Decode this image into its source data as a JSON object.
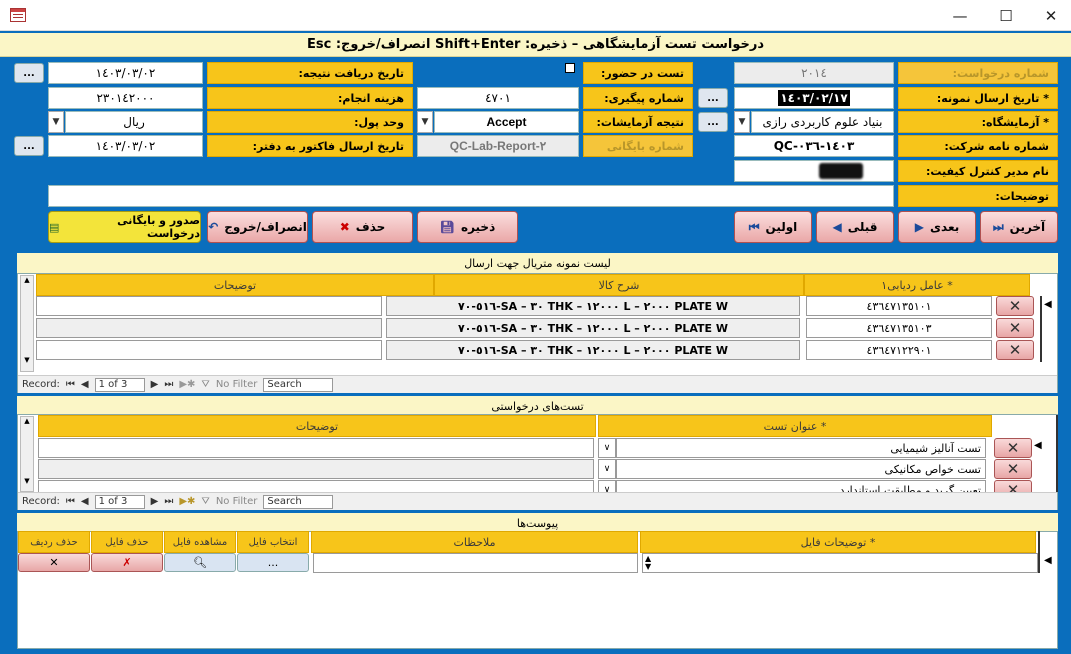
{
  "window": {
    "minimize": "—",
    "maximize": "☐",
    "close": "✕"
  },
  "form_title": "درخواست تست آزمایشگاهی  –  ذخیره: Shift+Enter     انصراف/خروج: Esc",
  "fields": {
    "request_no_label": "شماره درخواست:",
    "request_no": "٢٠١٤",
    "send_date_label": "* تاریخ ارسال نمونه:",
    "send_date": "١٤٠٣/٠٢/١٧",
    "lab_label": "* آزمایشگاه:",
    "lab": "بنیاد علوم کاربردی رازی",
    "letter_no_label": "شماره نامه شرکت:",
    "letter_no": "QC-١٤٠٣-٠٣٦",
    "qc_manager_label": "نام مدیر کنترل کیفیت:",
    "qc_manager": "",
    "notes_label": "توضیحات:",
    "notes": "",
    "attend_label": "تست در حضور:",
    "tracking_label": "شماره پیگیری:",
    "tracking": "٤٧٠١",
    "result_label": "نتیجه آزمایشات:",
    "result": "Accept",
    "archive_label": "شماره بایگانی",
    "archive": "QC-Lab-Report-٢",
    "result_date_label": "تاریخ دریافت نتیجه:",
    "result_date": "١٤٠٣/٠٣/٠٢",
    "cost_label": "هزینه انجام:",
    "cost": "٢٣٠١٤٢٠٠٠",
    "currency_label": "وحد پول:",
    "currency": "ریال",
    "invoice_date_label": "تاریخ ارسال فاکتور به دفتر:",
    "invoice_date": "١٤٠٣/٠٣/٠٢",
    "dots": "..."
  },
  "toolbar": {
    "last": "آخرین",
    "next": "بعدی",
    "prev": "قبلی",
    "first": "اولین",
    "save": "ذخیره",
    "delete": "حذف",
    "cancel": "انصراف/خروج",
    "issue": "صدور و بایگانی درخواست"
  },
  "samples": {
    "title": "لیست نمونه متریال جهت ارسال",
    "headers": [
      "* عامل ردیابی١",
      "شرح کالا",
      "توضیحات"
    ],
    "rows": [
      {
        "id": "٤٣٦٤٧١٣٥١٠١",
        "desc": "PLATE W ٢٠٠٠ – L ١٢٠٠٠ – THK ٣٠ – SA-٥١٦-٧٠",
        "note": ""
      },
      {
        "id": "٤٣٦٤٧١٣٥١٠٣",
        "desc": "PLATE W ٢٠٠٠ – L ١٢٠٠٠ – THK ٣٠ – SA-٥١٦-٧٠",
        "note": ""
      },
      {
        "id": "٤٣٦٤٧١٢٢٩٠١",
        "desc": "PLATE W ٢٠٠٠ – L ١٢٠٠٠ – THK ٣٠ – SA-٥١٦-٧٠",
        "note": ""
      }
    ],
    "nav": {
      "record": "Record:",
      "pos": "1 of 3",
      "filter": "No Filter",
      "search": "Search"
    }
  },
  "tests": {
    "title": "تست‌های درخواستی",
    "headers": [
      "* عنوان تست",
      "توضیحات"
    ],
    "rows": [
      {
        "name": "تست آنالیز شیمیایی",
        "note": ""
      },
      {
        "name": "تست خواص مکانیکی",
        "note": ""
      },
      {
        "name": "تعیین گرید و مطابقت استاندارد",
        "note": ""
      }
    ],
    "nav": {
      "record": "Record:",
      "pos": "1 of 3",
      "filter": "No Filter",
      "search": "Search"
    }
  },
  "attachments": {
    "title": "پیوست‌ها",
    "headers": [
      "* توضیحات فایل",
      "ملاحظات",
      "انتخاب فایل",
      "مشاهده فایل",
      "حذف فایل",
      "حذف ردیف"
    ],
    "select_btn": "..."
  },
  "colors": {
    "form_bg": "#0a6ebd",
    "label_bg": "#f7c51a",
    "header_bg": "#fbf6c6"
  }
}
